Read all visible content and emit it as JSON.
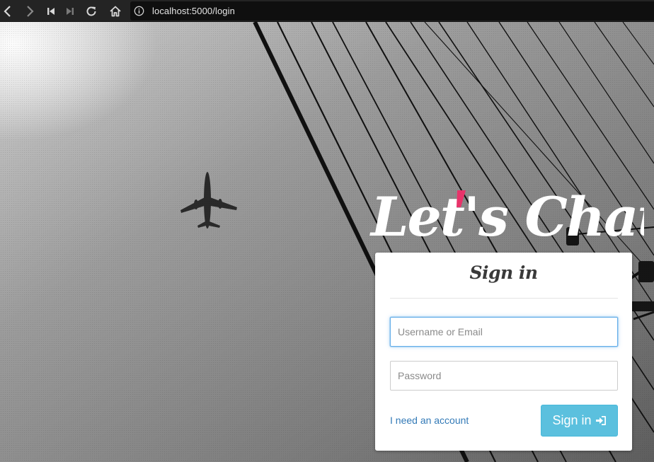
{
  "browser": {
    "url": "localhost:5000/login",
    "icons": [
      "back-icon",
      "forward-icon",
      "skip-back-icon",
      "skip-forward-icon",
      "reload-icon",
      "home-icon",
      "info-icon"
    ]
  },
  "brand": {
    "text": "Let's Chat",
    "accent_color": "#e8336a",
    "text_color": "#ffffff"
  },
  "login": {
    "title": "Sign in",
    "username_placeholder": "Username or Email",
    "password_placeholder": "Password",
    "account_link": "I need an account",
    "submit_label": "Sign in",
    "submit_icon": "sign-in-icon",
    "submit_color": "#5bc0de",
    "link_color": "#337ab7"
  }
}
